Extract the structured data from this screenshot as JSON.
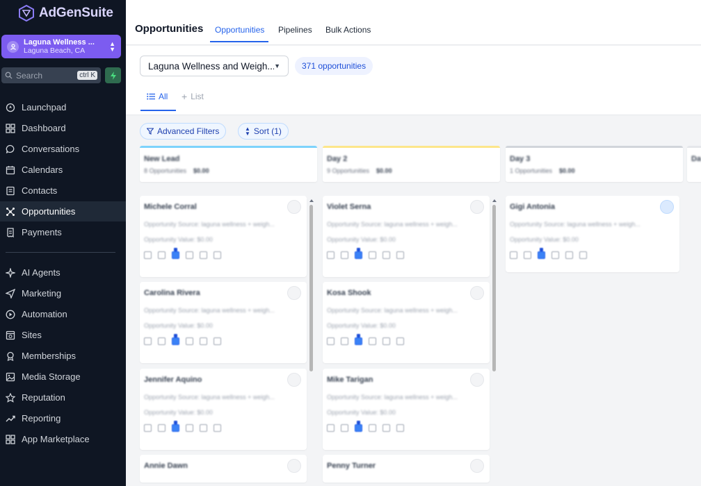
{
  "brand": {
    "name": "AdGenSuite",
    "accent": "#7c5cf0"
  },
  "location": {
    "name": "Laguna Wellness ...",
    "subtitle": "Laguna Beach, CA",
    "icon": "location-pin-icon"
  },
  "search": {
    "placeholder": "Search",
    "shortcut": "ctrl K"
  },
  "nav": {
    "primary": [
      {
        "label": "Launchpad",
        "icon": "rocket-icon"
      },
      {
        "label": "Dashboard",
        "icon": "grid-icon"
      },
      {
        "label": "Conversations",
        "icon": "chat-icon"
      },
      {
        "label": "Calendars",
        "icon": "calendar-icon"
      },
      {
        "label": "Contacts",
        "icon": "contacts-icon"
      },
      {
        "label": "Opportunities",
        "icon": "network-icon",
        "active": true
      },
      {
        "label": "Payments",
        "icon": "receipt-icon"
      }
    ],
    "secondary": [
      {
        "label": "AI Agents",
        "icon": "sparkle-icon"
      },
      {
        "label": "Marketing",
        "icon": "send-icon"
      },
      {
        "label": "Automation",
        "icon": "play-circle-icon"
      },
      {
        "label": "Sites",
        "icon": "globe-window-icon"
      },
      {
        "label": "Memberships",
        "icon": "badge-icon"
      },
      {
        "label": "Media Storage",
        "icon": "image-icon"
      },
      {
        "label": "Reputation",
        "icon": "star-icon"
      },
      {
        "label": "Reporting",
        "icon": "trend-icon"
      },
      {
        "label": "App Marketplace",
        "icon": "apps-icon"
      }
    ]
  },
  "header": {
    "title": "Opportunities",
    "tabs": [
      "Opportunities",
      "Pipelines",
      "Bulk Actions"
    ],
    "active_tab": "Opportunities"
  },
  "toolbar": {
    "pipeline": "Laguna Wellness and Weigh...",
    "count": "371 opportunities",
    "views": [
      "All",
      "List"
    ],
    "filters_label": "Advanced Filters",
    "sort_label": "Sort (1)"
  },
  "columns": [
    {
      "title": "New Lead",
      "count": "8 Opportunities",
      "total": "$0.00",
      "color": "#7dd3fc",
      "cards": [
        {
          "name": "Michele Corral",
          "source": "Opportunity Source: laguna wellness + weigh...",
          "value": "Opportunity Value: $0.00"
        },
        {
          "name": "Carolina Rivera",
          "source": "Opportunity Source: laguna wellness + weigh...",
          "value": "Opportunity Value: $0.00"
        },
        {
          "name": "Jennifer Aquino",
          "source": "Opportunity Source: laguna wellness + weigh...",
          "value": "Opportunity Value: $0.00"
        },
        {
          "name": "Annie Dawn"
        }
      ]
    },
    {
      "title": "Day 2",
      "count": "9 Opportunities",
      "total": "$0.00",
      "color": "#fde68a",
      "cards": [
        {
          "name": "Violet Serna",
          "source": "Opportunity Source: laguna wellness + weigh...",
          "value": "Opportunity Value: $0.00"
        },
        {
          "name": "Kosa Shook",
          "source": "Opportunity Source: laguna wellness + weigh...",
          "value": "Opportunity Value: $0.00"
        },
        {
          "name": "Mike Tarigan",
          "source": "Opportunity Source: laguna wellness + weigh...",
          "value": "Opportunity Value: $0.00"
        },
        {
          "name": "Penny Turner"
        }
      ]
    },
    {
      "title": "Day 3",
      "count": "1 Opportunities",
      "total": "$0.00",
      "color": "#d1d5db",
      "cards": [
        {
          "name": "Gigi Antonia",
          "source": "Opportunity Source: laguna wellness + weigh...",
          "value": "Opportunity Value: $0.00"
        }
      ]
    },
    {
      "title": "Da",
      "color": "#e5e7eb"
    }
  ]
}
